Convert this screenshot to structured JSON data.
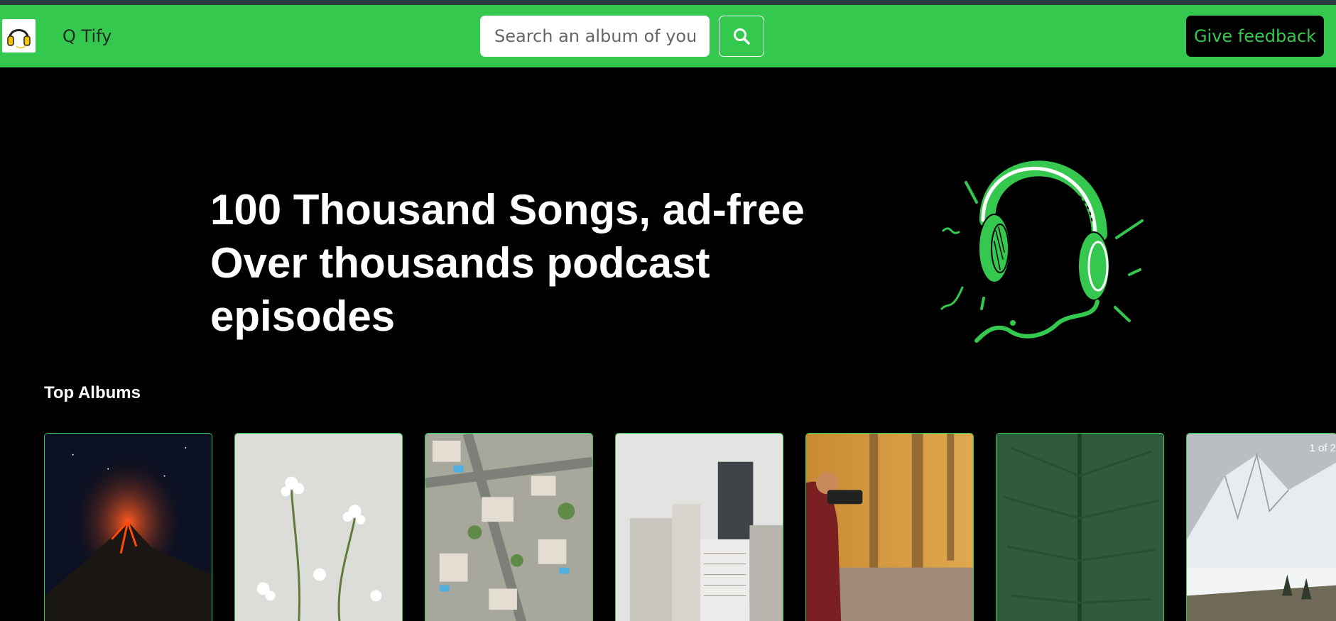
{
  "app": {
    "name": "Q Tify"
  },
  "search": {
    "placeholder": "Search an album of you"
  },
  "header": {
    "feedback_label": "Give feedback"
  },
  "hero": {
    "lines": [
      "100 Thousand Songs, ad-free",
      "Over thousands podcast",
      "episodes"
    ]
  },
  "top_albums": {
    "title": "Top Albums",
    "pager_text": "1 of 2",
    "albums": [
      {
        "image": "volcano-night"
      },
      {
        "image": "white-flowers"
      },
      {
        "image": "aerial-houses"
      },
      {
        "image": "city-buildings"
      },
      {
        "image": "photographer-forest"
      },
      {
        "image": "green-leaf"
      },
      {
        "image": "snowy-mountains"
      }
    ]
  },
  "colors": {
    "accent": "#34c94e",
    "background": "#000000",
    "topstrip": "#2b3a40"
  }
}
